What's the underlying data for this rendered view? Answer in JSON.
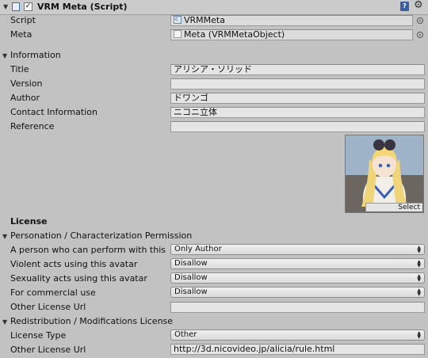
{
  "component": {
    "title": "VRM Meta (Script)",
    "enabled": true,
    "script_label": "Script",
    "script_value": "VRMMeta",
    "meta_label": "Meta",
    "meta_value": "Meta (VRMMetaObject)"
  },
  "information": {
    "header": "Information",
    "fields": [
      {
        "label": "Title",
        "value": "アリシア・ソリッド"
      },
      {
        "label": "Version",
        "value": ""
      },
      {
        "label": "Author",
        "value": "ドワンゴ"
      },
      {
        "label": "Contact Information",
        "value": "ニコニ立体"
      },
      {
        "label": "Reference",
        "value": ""
      }
    ],
    "thumbnail_button": "Select"
  },
  "license": {
    "header": "License",
    "personation": {
      "header": "Personation / Characterization Permission",
      "rows": [
        {
          "label": "A person who can perform with this",
          "value": "Only Author"
        },
        {
          "label": "Violent acts using this avatar",
          "value": "Disallow"
        },
        {
          "label": "Sexuality acts using this avatar",
          "value": "Disallow"
        },
        {
          "label": "For commercial use",
          "value": "Disallow"
        }
      ],
      "other_license_label": "Other License Url",
      "other_license_value": ""
    },
    "redistribution": {
      "header": "Redistribution / Modifications License",
      "license_type_label": "License Type",
      "license_type_value": "Other",
      "other_license_label": "Other License Url",
      "other_license_value": "http://3d.nicovideo.jp/alicia/rule.html"
    }
  },
  "icons": [
    "foldout-arrow-icon",
    "script-icon",
    "help-book-icon",
    "gear-icon",
    "object-picker-icon"
  ]
}
